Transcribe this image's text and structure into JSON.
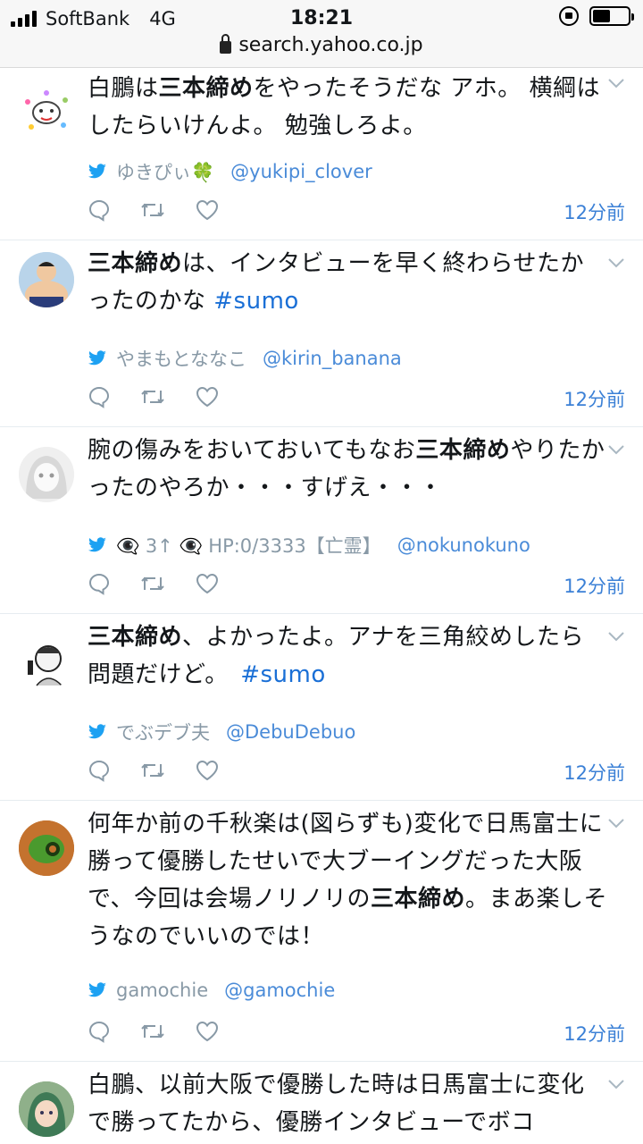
{
  "status_bar": {
    "carrier": "SoftBank",
    "network": "4G",
    "time": "18:21",
    "battery_level": 0.5
  },
  "url_bar": {
    "domain": "search.yahoo.co.jp"
  },
  "tweets": [
    {
      "text_parts": [
        {
          "t": "白鵬は"
        },
        {
          "t": "三本締め",
          "b": true
        },
        {
          "t": "をやったそうだな アホ。 横綱はしたらいけんよ。 勉強しろよ。"
        }
      ],
      "display_name": "ゆきぴぃ🍀",
      "handle": "@yukipi_clover",
      "time": "12分前"
    },
    {
      "text_parts": [
        {
          "t": "三本締め",
          "b": true
        },
        {
          "t": "は、インタビューを早く終わらせたかったのかな "
        },
        {
          "t": "#sumo",
          "tag": true
        }
      ],
      "display_name": "やまもとななこ",
      "handle": "@kirin_banana",
      "time": "12分前"
    },
    {
      "text_parts": [
        {
          "t": "腕の傷みをおいておいてもなお"
        },
        {
          "t": "三本締め",
          "b": true
        },
        {
          "t": "やりたかったのやろか・・・すげえ・・・"
        }
      ],
      "display_name": "👁‍🗨 3↑ 👁‍🗨 HP:0/3333【亡霊】",
      "handle": "@nokunokuno",
      "time": "12分前"
    },
    {
      "text_parts": [
        {
          "t": "三本締め",
          "b": true
        },
        {
          "t": "、よかったよ。アナを三角絞めしたら問題だけど。　"
        },
        {
          "t": "#sumo",
          "tag": true
        }
      ],
      "display_name": "でぶデブ夫",
      "handle": "@DebuDebuo",
      "time": "12分前"
    },
    {
      "text_parts": [
        {
          "t": "何年か前の千秋楽は(図らずも)変化で日馬富士に勝って優勝したせいで大ブーイングだった大阪で、今回は会場ノリノリの"
        },
        {
          "t": "三本締め",
          "b": true
        },
        {
          "t": "。まあ楽しそうなのでいいのでは！"
        }
      ],
      "display_name": "gamochie",
      "handle": "@gamochie",
      "time": "12分前"
    },
    {
      "text_parts": [
        {
          "t": "白鵬、以前大阪で優勝した時は日馬富士に変化で勝ってたから、優勝インタビューでボコ"
        }
      ],
      "display_name": "",
      "handle": "",
      "time": ""
    }
  ]
}
